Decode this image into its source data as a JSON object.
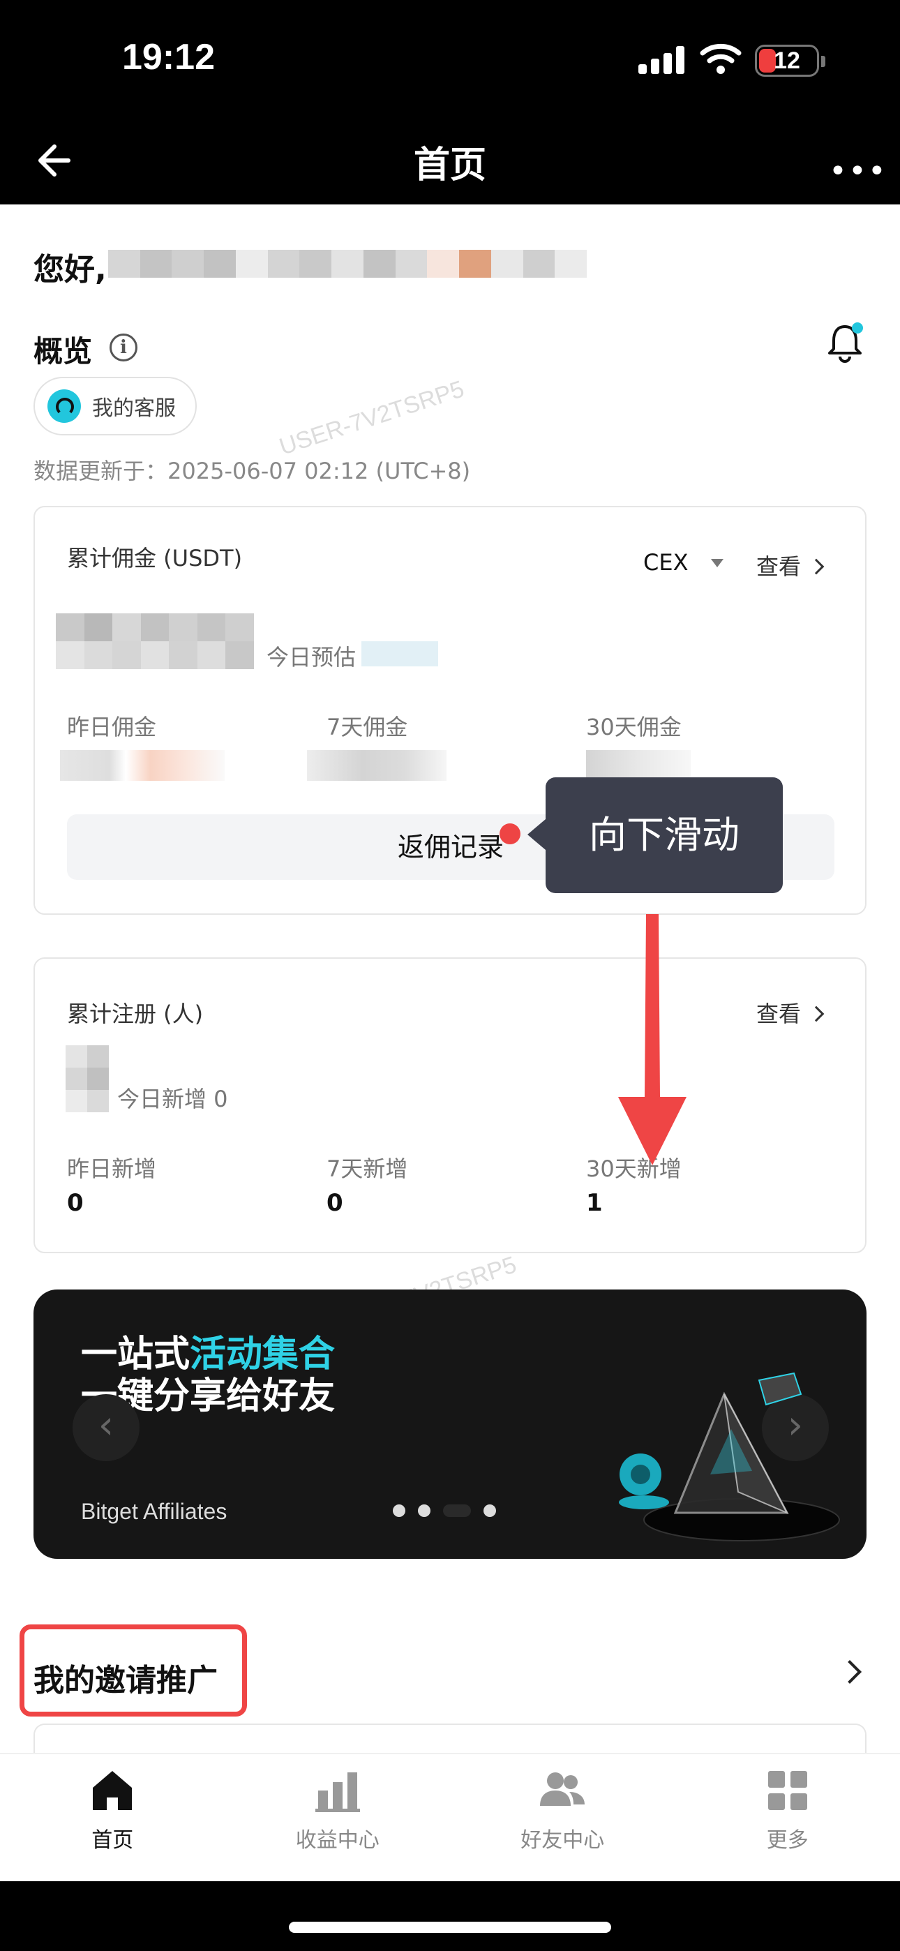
{
  "status_bar": {
    "time": "19:12",
    "battery": "12"
  },
  "header": {
    "title": "首页"
  },
  "greeting": "您好,",
  "overview": {
    "title": "概览",
    "support_label": "我的客服",
    "updated": "数据更新于：2025-06-07 02:12 (UTC+8)",
    "watermark": "USER-7V2TSRP5"
  },
  "commission_card": {
    "title": "累计佣金 (USDT)",
    "selector": "CEX",
    "view": "查看",
    "today_label": "今日预估",
    "stats": [
      "昨日佣金",
      "7天佣金",
      "30天佣金"
    ],
    "rebate_button": "返佣记录"
  },
  "tooltip": "向下滑动",
  "register_card": {
    "title": "累计注册 (人)",
    "view": "查看",
    "today_label": "今日新增 0",
    "stats": [
      {
        "label": "昨日新增",
        "value": "0"
      },
      {
        "label": "7天新增",
        "value": "0"
      },
      {
        "label": "30天新增",
        "value": "1"
      }
    ]
  },
  "banner": {
    "line1_prefix": "一站式",
    "line1_highlight": "活动集合",
    "line2": "一键分享给好友",
    "footer": "Bitget Affiliates",
    "dot_count": 4,
    "active_dot": 3
  },
  "invite": {
    "title": "我的邀请推广"
  },
  "tabbar": [
    {
      "label": "首页",
      "icon": "home-icon",
      "active": true
    },
    {
      "label": "收益中心",
      "icon": "bar-chart-icon",
      "active": false
    },
    {
      "label": "好友中心",
      "icon": "users-icon",
      "active": false
    },
    {
      "label": "更多",
      "icon": "grid-icon",
      "active": false
    }
  ],
  "colors": {
    "accent": "#2fd2e6",
    "annotation": "#ef4545",
    "tooltip_bg": "#3c3f4d"
  }
}
